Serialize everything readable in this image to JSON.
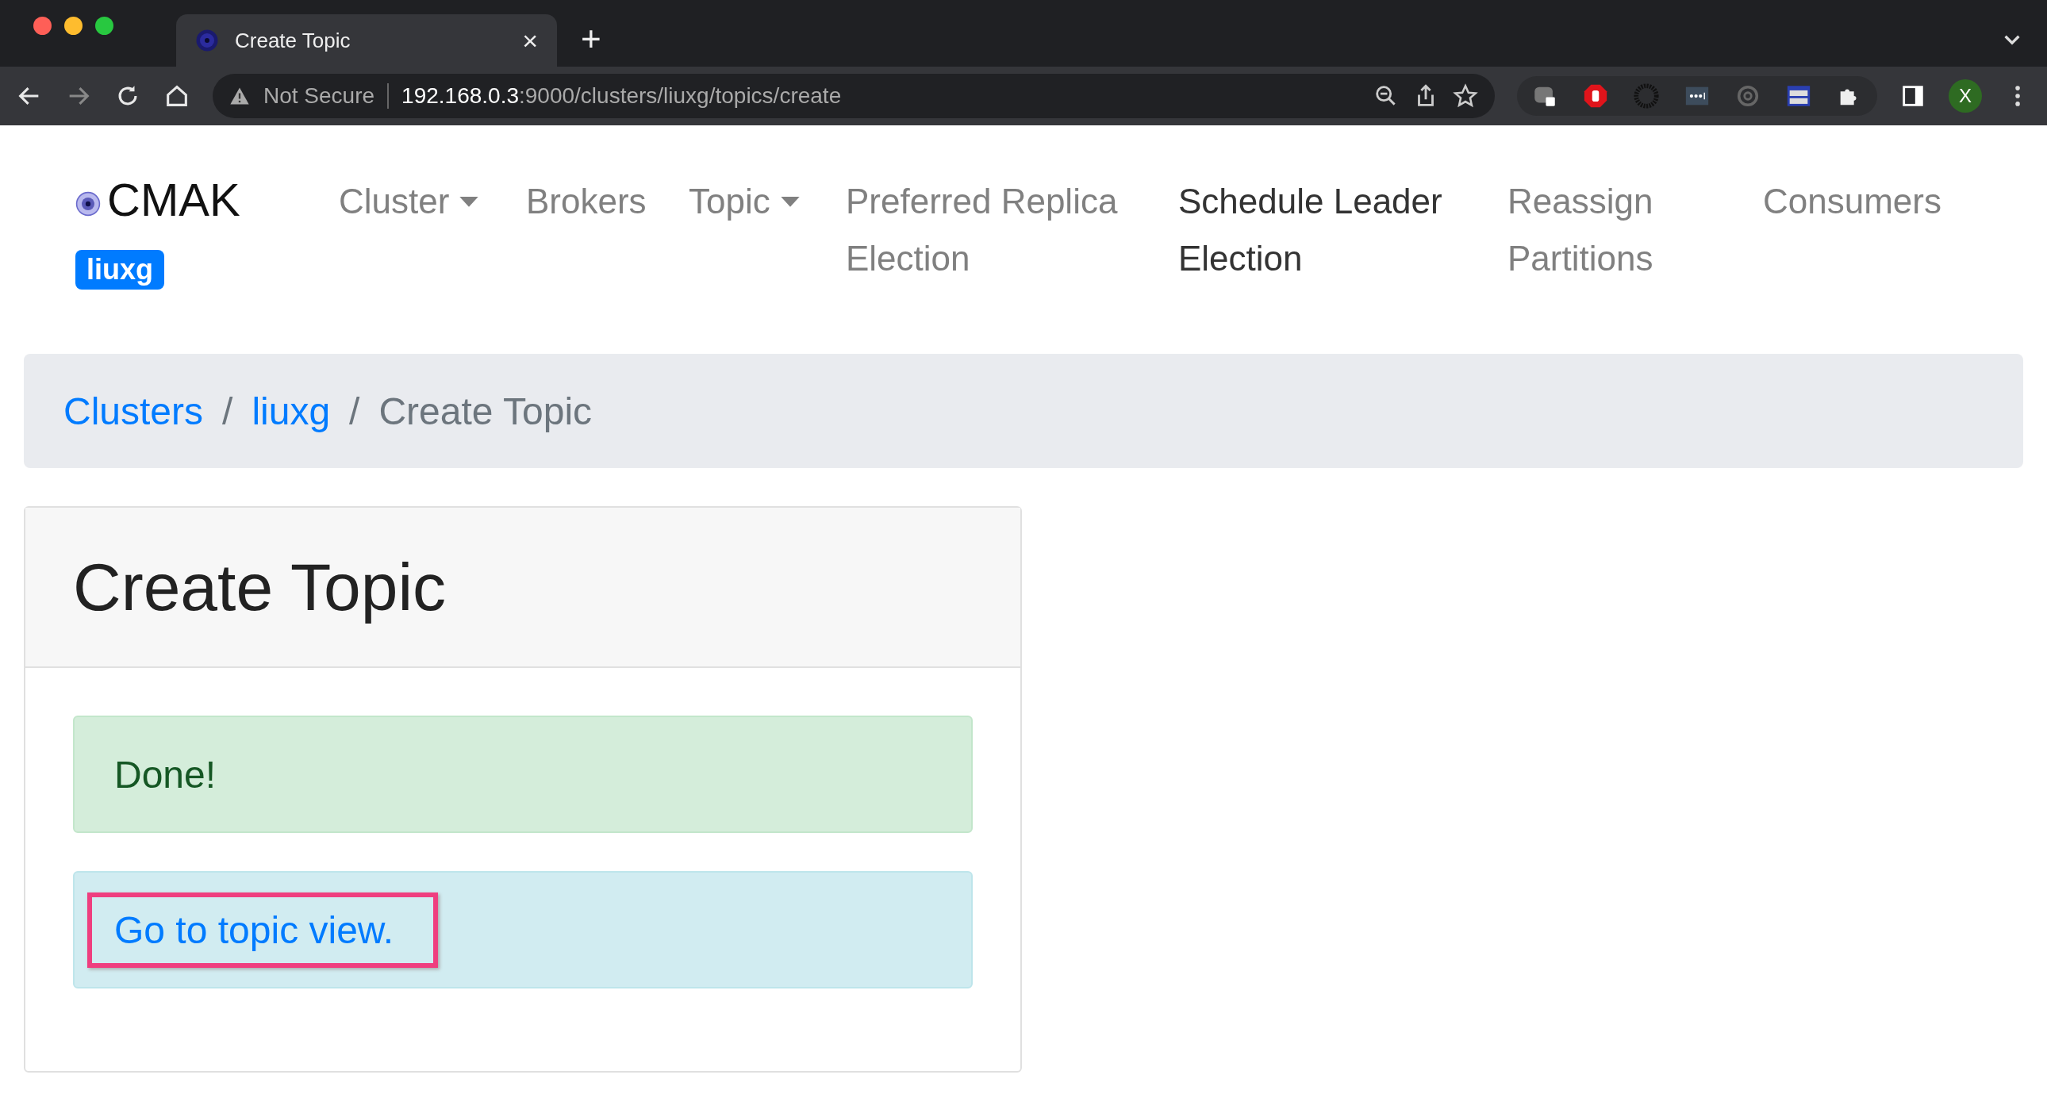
{
  "browser": {
    "tabs": [
      {
        "title": "Create Topic",
        "selected": true
      }
    ],
    "new_tab": "+",
    "close": "×",
    "address": {
      "security": "Not Secure",
      "host": "192.168.0.3",
      "path": ":9000/clusters/liuxg/topics/create"
    },
    "profile": "X"
  },
  "navbar": {
    "brand": "CMAK",
    "cluster_badge": "liuxg",
    "items": [
      {
        "label": "Cluster",
        "dropdown": true,
        "selected": false
      },
      {
        "label": "Brokers",
        "dropdown": false,
        "selected": false
      },
      {
        "label": "Topic",
        "dropdown": true,
        "selected": false
      },
      {
        "label": "Preferred Replica Election",
        "dropdown": false,
        "selected": false
      },
      {
        "label": "Schedule Leader Election",
        "dropdown": false,
        "selected": true
      },
      {
        "label": "Reassign Partitions",
        "dropdown": false,
        "selected": false
      },
      {
        "label": "Consumers",
        "dropdown": false,
        "selected": false
      }
    ]
  },
  "breadcrumb": [
    {
      "label": "Clusters",
      "kind": "link"
    },
    {
      "label": "/",
      "kind": "separator"
    },
    {
      "label": "liuxg",
      "kind": "link"
    },
    {
      "label": "/",
      "kind": "separator"
    },
    {
      "label": "Create Topic",
      "kind": "current"
    }
  ],
  "card": {
    "title": "Create Topic",
    "alerts": [
      {
        "kind": "success",
        "text": "Done!",
        "highlighted": false
      },
      {
        "kind": "info",
        "text": "Go to topic view.",
        "highlighted": true
      }
    ]
  }
}
